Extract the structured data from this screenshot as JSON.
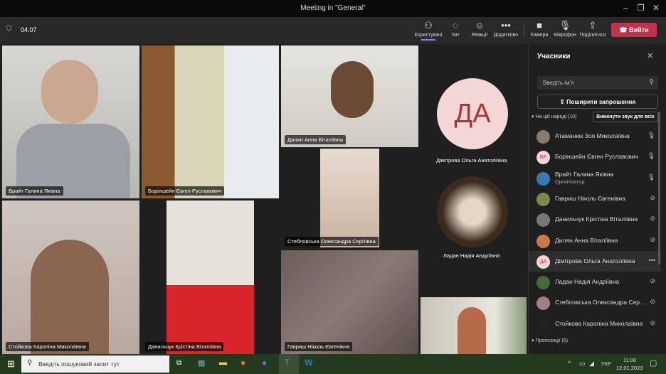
{
  "window": {
    "title": "Meeting in \"General\""
  },
  "toolbar": {
    "timer": "04:07",
    "buttons": [
      {
        "label": "Користувачі",
        "icon": "people-icon"
      },
      {
        "label": "Чат",
        "icon": "chat-icon"
      },
      {
        "label": "Реакції",
        "icon": "reactions-icon"
      },
      {
        "label": "Додатково",
        "icon": "more-icon"
      },
      {
        "label": "Камера",
        "icon": "camera-icon"
      },
      {
        "label": "Мікрофон",
        "icon": "mic-icon"
      },
      {
        "label": "Поділитися",
        "icon": "share-icon"
      }
    ],
    "leave": "Вийти"
  },
  "tiles": [
    {
      "name": "Врайт Галина Яківна"
    },
    {
      "name": "Боріншейн Євген Руславович"
    },
    {
      "name": "Дилян Анна Віталіївна"
    },
    {
      "name": "Дімітрова Ольга Анатоліївна",
      "initials": "ДА"
    },
    {
      "name": "Стебловська Олександра Сергіївна"
    },
    {
      "name": "Ладан Надія Андріївна"
    },
    {
      "name": "Стойкова Кароліна Миколаївна"
    },
    {
      "name": "Данильчук Крістіна Віталіївна"
    },
    {
      "name": "Гавриш Ніколь Євгенівна"
    }
  ],
  "panel": {
    "title": "Учасники",
    "search_placeholder": "Введіть ім'я",
    "share": "Поширити запрошення",
    "section": "На цій нараді (10)",
    "mute_all": "Вимкнути звук для всіх",
    "suggestions": "Пропозиції (5)",
    "participants": [
      {
        "name": "Атаманюк Зоя Миколаївна",
        "mic": "on",
        "color": "#8a7a6a"
      },
      {
        "name": "Боріншейн Євген Руславович",
        "mic": "on",
        "initials": "БР",
        "color": "#f3d6d6"
      },
      {
        "name": "Врайт Галина Яківна",
        "role": "Організатор",
        "mic": "on",
        "color": "#3a7ab0"
      },
      {
        "name": "Гавриш Ніколь Євгенівна",
        "mic": "off",
        "color": "#7a8a4a"
      },
      {
        "name": "Данильчук Крістіна Віталіївна",
        "mic": "off",
        "color": "#777"
      },
      {
        "name": "Дилян Анна Віталіївна",
        "mic": "off",
        "color": "#c77a4a"
      },
      {
        "name": "Дімітрова Ольга Анатоліївна",
        "mic": "more",
        "initials": "ДА",
        "color": "#f3d6d6"
      },
      {
        "name": "Ладан Надія Андріївна",
        "mic": "off",
        "color": "#4a6a3a"
      },
      {
        "name": "Стебловська Олександра Сергіївна",
        "mic": "off",
        "color": "#a08080"
      },
      {
        "name": "Стойкова Кароліна Миколаївна",
        "mic": "off",
        "color": "#222"
      }
    ]
  },
  "taskbar": {
    "search_placeholder": "Введіть пошуковий запит тут",
    "lang": "УКР",
    "time": "11:00",
    "date": "12.01.2023"
  }
}
